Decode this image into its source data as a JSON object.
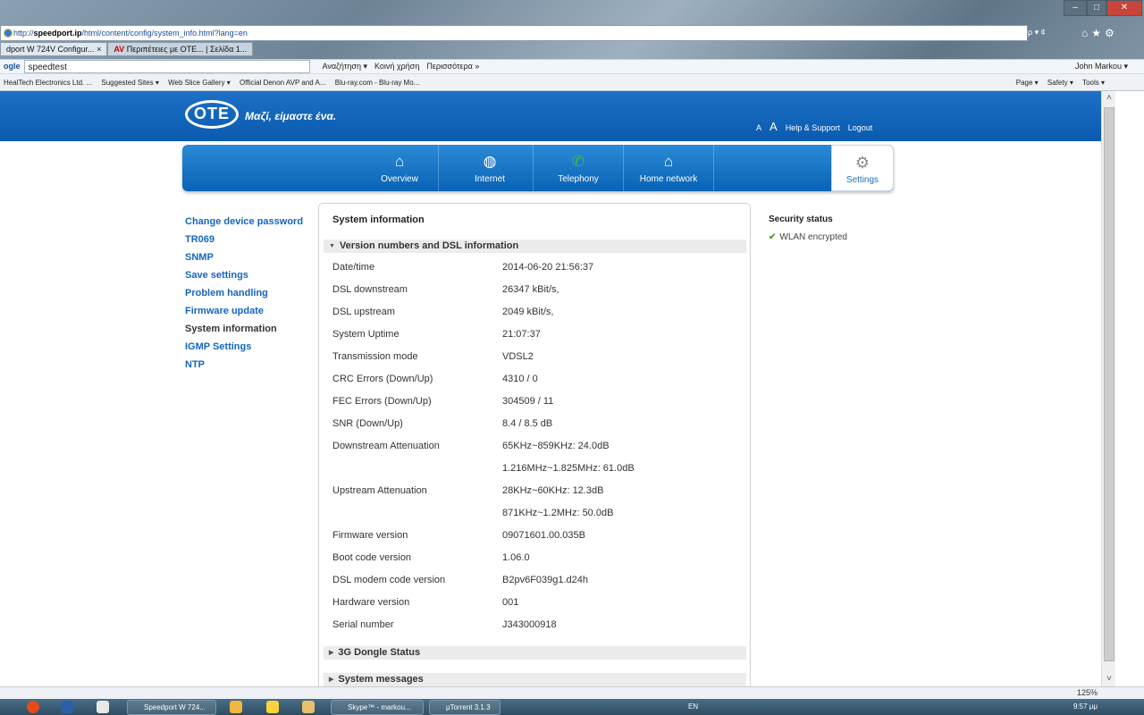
{
  "browser": {
    "address_prefix": "http://",
    "address_host": "speedport.ip",
    "address_path": "/html/content/config/system_info.html?lang=en",
    "tabs": [
      "dport W 724V Configur...",
      "Περιπέτειες με OTE... | Σελίδα 1..."
    ],
    "tab_close": "×",
    "search_box": "speedtest",
    "toolbar_items": [
      "Αναζήτηση ▾",
      "Κοινή χρήση",
      "Περισσότερα »"
    ],
    "user": "John Markou ▾",
    "favorites": [
      "HealTech Electronics Ltd. ...",
      "Suggested Sites ▾",
      "Web Slice Gallery ▾",
      "Official Denon AVP and A...",
      "Blu-ray.com - Blu-ray Mo..."
    ],
    "command_items": [
      "Page ▾",
      "Safety ▾",
      "Tools ▾"
    ],
    "search_ctrl": "ρ ▾ ¢",
    "zoom": "125%"
  },
  "header": {
    "logo": "OTE",
    "slogan": "Μαζί, είμαστε ένα.",
    "font_small": "A",
    "font_large": "A",
    "help": "Help & Support",
    "logout": "Logout"
  },
  "menu": {
    "items": [
      "Overview",
      "Internet",
      "Telephony",
      "Home network"
    ],
    "settings": "Settings"
  },
  "sidenav": [
    "Change device password",
    "TR069",
    "SNMP",
    "Save settings",
    "Problem handling",
    "Firmware update",
    "System information",
    "IGMP Settings",
    "NTP"
  ],
  "panel": {
    "title": "System information",
    "section1": "Version numbers and DSL information",
    "rows": [
      {
        "label": "Date/time",
        "value": "2014-06-20 21:56:37"
      },
      {
        "label": "DSL downstream",
        "value": "26347 kBit/s,"
      },
      {
        "label": "DSL upstream",
        "value": "2049 kBit/s,"
      },
      {
        "label": "System Uptime",
        "value": "21:07:37"
      },
      {
        "label": "Transmission mode",
        "value": "VDSL2"
      },
      {
        "label": "CRC Errors (Down/Up)",
        "value": "4310 / 0"
      },
      {
        "label": "FEC Errors (Down/Up)",
        "value": "304509 / 11"
      },
      {
        "label": "SNR (Down/Up)",
        "value": "8.4 / 8.5 dB"
      },
      {
        "label": "Downstream Attenuation",
        "value": "65KHz~859KHz: 24.0dB"
      },
      {
        "label": "",
        "value": "1.216MHz~1.825MHz: 61.0dB"
      },
      {
        "label": "Upstream Attenuation",
        "value": "28KHz~60KHz: 12.3dB"
      },
      {
        "label": "",
        "value": "871KHz~1.2MHz: 50.0dB"
      },
      {
        "label": "Firmware version",
        "value": "09071601.00.035B"
      },
      {
        "label": "Boot code version",
        "value": "1.06.0"
      },
      {
        "label": "DSL modem code version",
        "value": "B2pv6F039g1.d24h"
      },
      {
        "label": "Hardware version",
        "value": "001"
      },
      {
        "label": "Serial number",
        "value": "J343000918"
      }
    ],
    "section2": "3G Dongle Status",
    "section3": "System messages"
  },
  "security": {
    "title": "Security status",
    "item": "WLAN encrypted"
  },
  "taskbar": {
    "buttons": [
      "Speedport W 724...",
      "Skype™ - markou...",
      "µTorrent 3.1.3"
    ],
    "lang": "EN",
    "clock": "9:57 μμ"
  }
}
